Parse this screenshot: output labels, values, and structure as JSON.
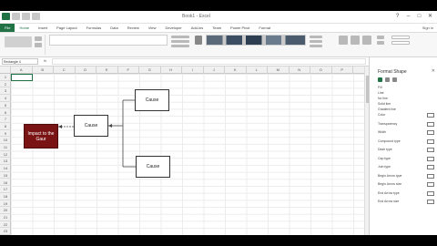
{
  "window": {
    "title": "Book1 - Excel"
  },
  "tabs": {
    "file": "File",
    "items": [
      "Home",
      "Insert",
      "Page Layout",
      "Formulas",
      "Data",
      "Review",
      "View",
      "Developer",
      "Add-ins",
      "Team",
      "Power Pivot",
      "Format"
    ]
  },
  "account": {
    "signin": "Sign in"
  },
  "formula_bar": {
    "name_box": "Rectangle 4",
    "fx": "fx",
    "value": ""
  },
  "columns": [
    "A",
    "B",
    "C",
    "D",
    "E",
    "F",
    "G",
    "H",
    "I",
    "J",
    "K",
    "L",
    "M",
    "N",
    "O",
    "P"
  ],
  "rows": [
    "1",
    "2",
    "3",
    "4",
    "5",
    "6",
    "7",
    "8",
    "9",
    "10",
    "11",
    "12",
    "13",
    "14",
    "15",
    "16",
    "17",
    "18",
    "19",
    "20",
    "21",
    "22",
    "23",
    "24"
  ],
  "diagram": {
    "effect": "Impact to the Gaur",
    "cause_mid": "Cause",
    "cause_top": "Cause",
    "cause_bottom": "Cause"
  },
  "format_pane": {
    "title": "Format Shape",
    "labels": [
      "Fill",
      "Line",
      "No line",
      "Solid line",
      "Gradient line",
      "Color",
      "Transparency",
      "Width",
      "Compound type",
      "Dash type",
      "Cap type",
      "Join type",
      "Begin Arrow type",
      "Begin Arrow size",
      "End Arrow type",
      "End Arrow size"
    ]
  },
  "colors": {
    "excel_green": "#217346",
    "effect_fill": "#7a1313"
  }
}
